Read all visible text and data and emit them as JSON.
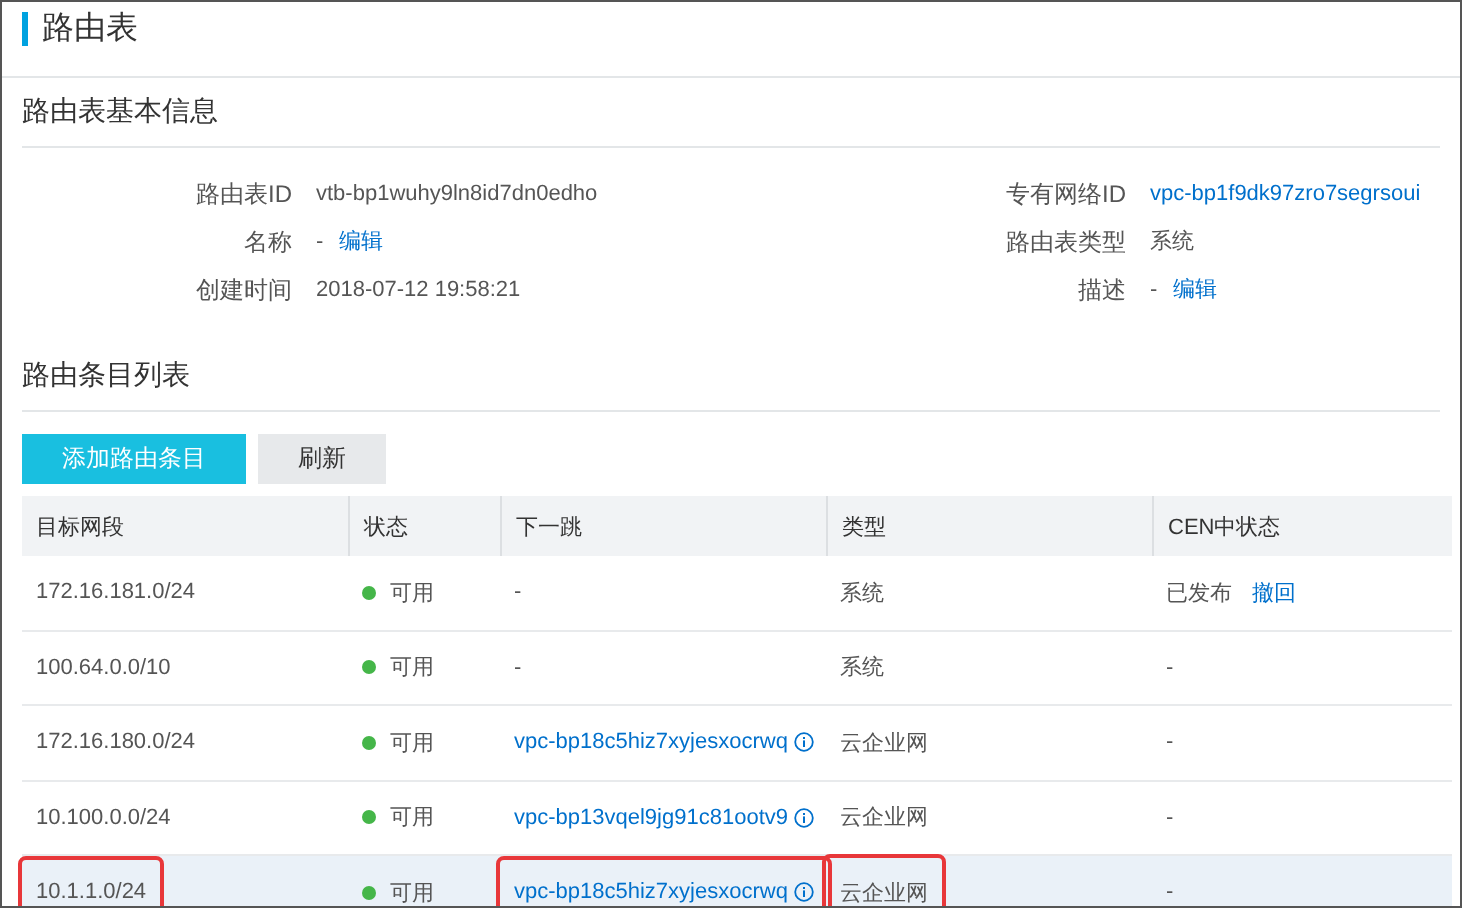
{
  "page": {
    "title": "路由表"
  },
  "basic_info": {
    "heading": "路由表基本信息",
    "fields": [
      {
        "label": "路由表ID",
        "value": "vtb-bp1wuhy9ln8id7dn0edho",
        "kind": "text"
      },
      {
        "label": "专有网络ID",
        "value": "vpc-bp1f9dk97zro7segrsoui",
        "kind": "link"
      },
      {
        "label": "名称",
        "value": "-",
        "action": "编辑",
        "kind": "editable"
      },
      {
        "label": "路由表类型",
        "value": "系统",
        "kind": "text"
      },
      {
        "label": "创建时间",
        "value": "2018-07-12 19:58:21",
        "kind": "text"
      },
      {
        "label": "描述",
        "value": "-",
        "action": "编辑",
        "kind": "editable"
      }
    ]
  },
  "entries": {
    "heading": "路由条目列表",
    "buttons": [
      {
        "label": "添加路由条目",
        "kind": "primary"
      },
      {
        "label": "刷新",
        "kind": "secondary"
      }
    ],
    "columns": [
      "目标网段",
      "状态",
      "下一跳",
      "类型",
      "CEN中状态"
    ],
    "rows": [
      {
        "destination": "172.16.181.0/24",
        "status": "可用",
        "next_hop": {
          "text": "-",
          "kind": "text"
        },
        "type": "系统",
        "cen_status": "已发布",
        "cen_action": "撤回",
        "hovered": false,
        "annotated": false
      },
      {
        "destination": "100.64.0.0/10",
        "status": "可用",
        "next_hop": {
          "text": "-",
          "kind": "text"
        },
        "type": "系统",
        "cen_status": "-",
        "hovered": false,
        "annotated": false
      },
      {
        "destination": "172.16.180.0/24",
        "status": "可用",
        "next_hop": {
          "text": "vpc-bp18c5hiz7xyjesxocrwq",
          "kind": "link"
        },
        "type": "云企业网",
        "cen_status": "-",
        "hovered": false,
        "annotated": false
      },
      {
        "destination": "10.100.0.0/24",
        "status": "可用",
        "next_hop": {
          "text": "vpc-bp13vqel9jg91c81ootv9",
          "kind": "link"
        },
        "type": "云企业网",
        "cen_status": "-",
        "hovered": false,
        "annotated": false
      },
      {
        "destination": "10.1.1.0/24",
        "status": "可用",
        "next_hop": {
          "text": "vpc-bp18c5hiz7xyjesxocrwq",
          "kind": "link"
        },
        "type": "云企业网",
        "cen_status": "-",
        "hovered": true,
        "annotated": true
      }
    ]
  }
}
